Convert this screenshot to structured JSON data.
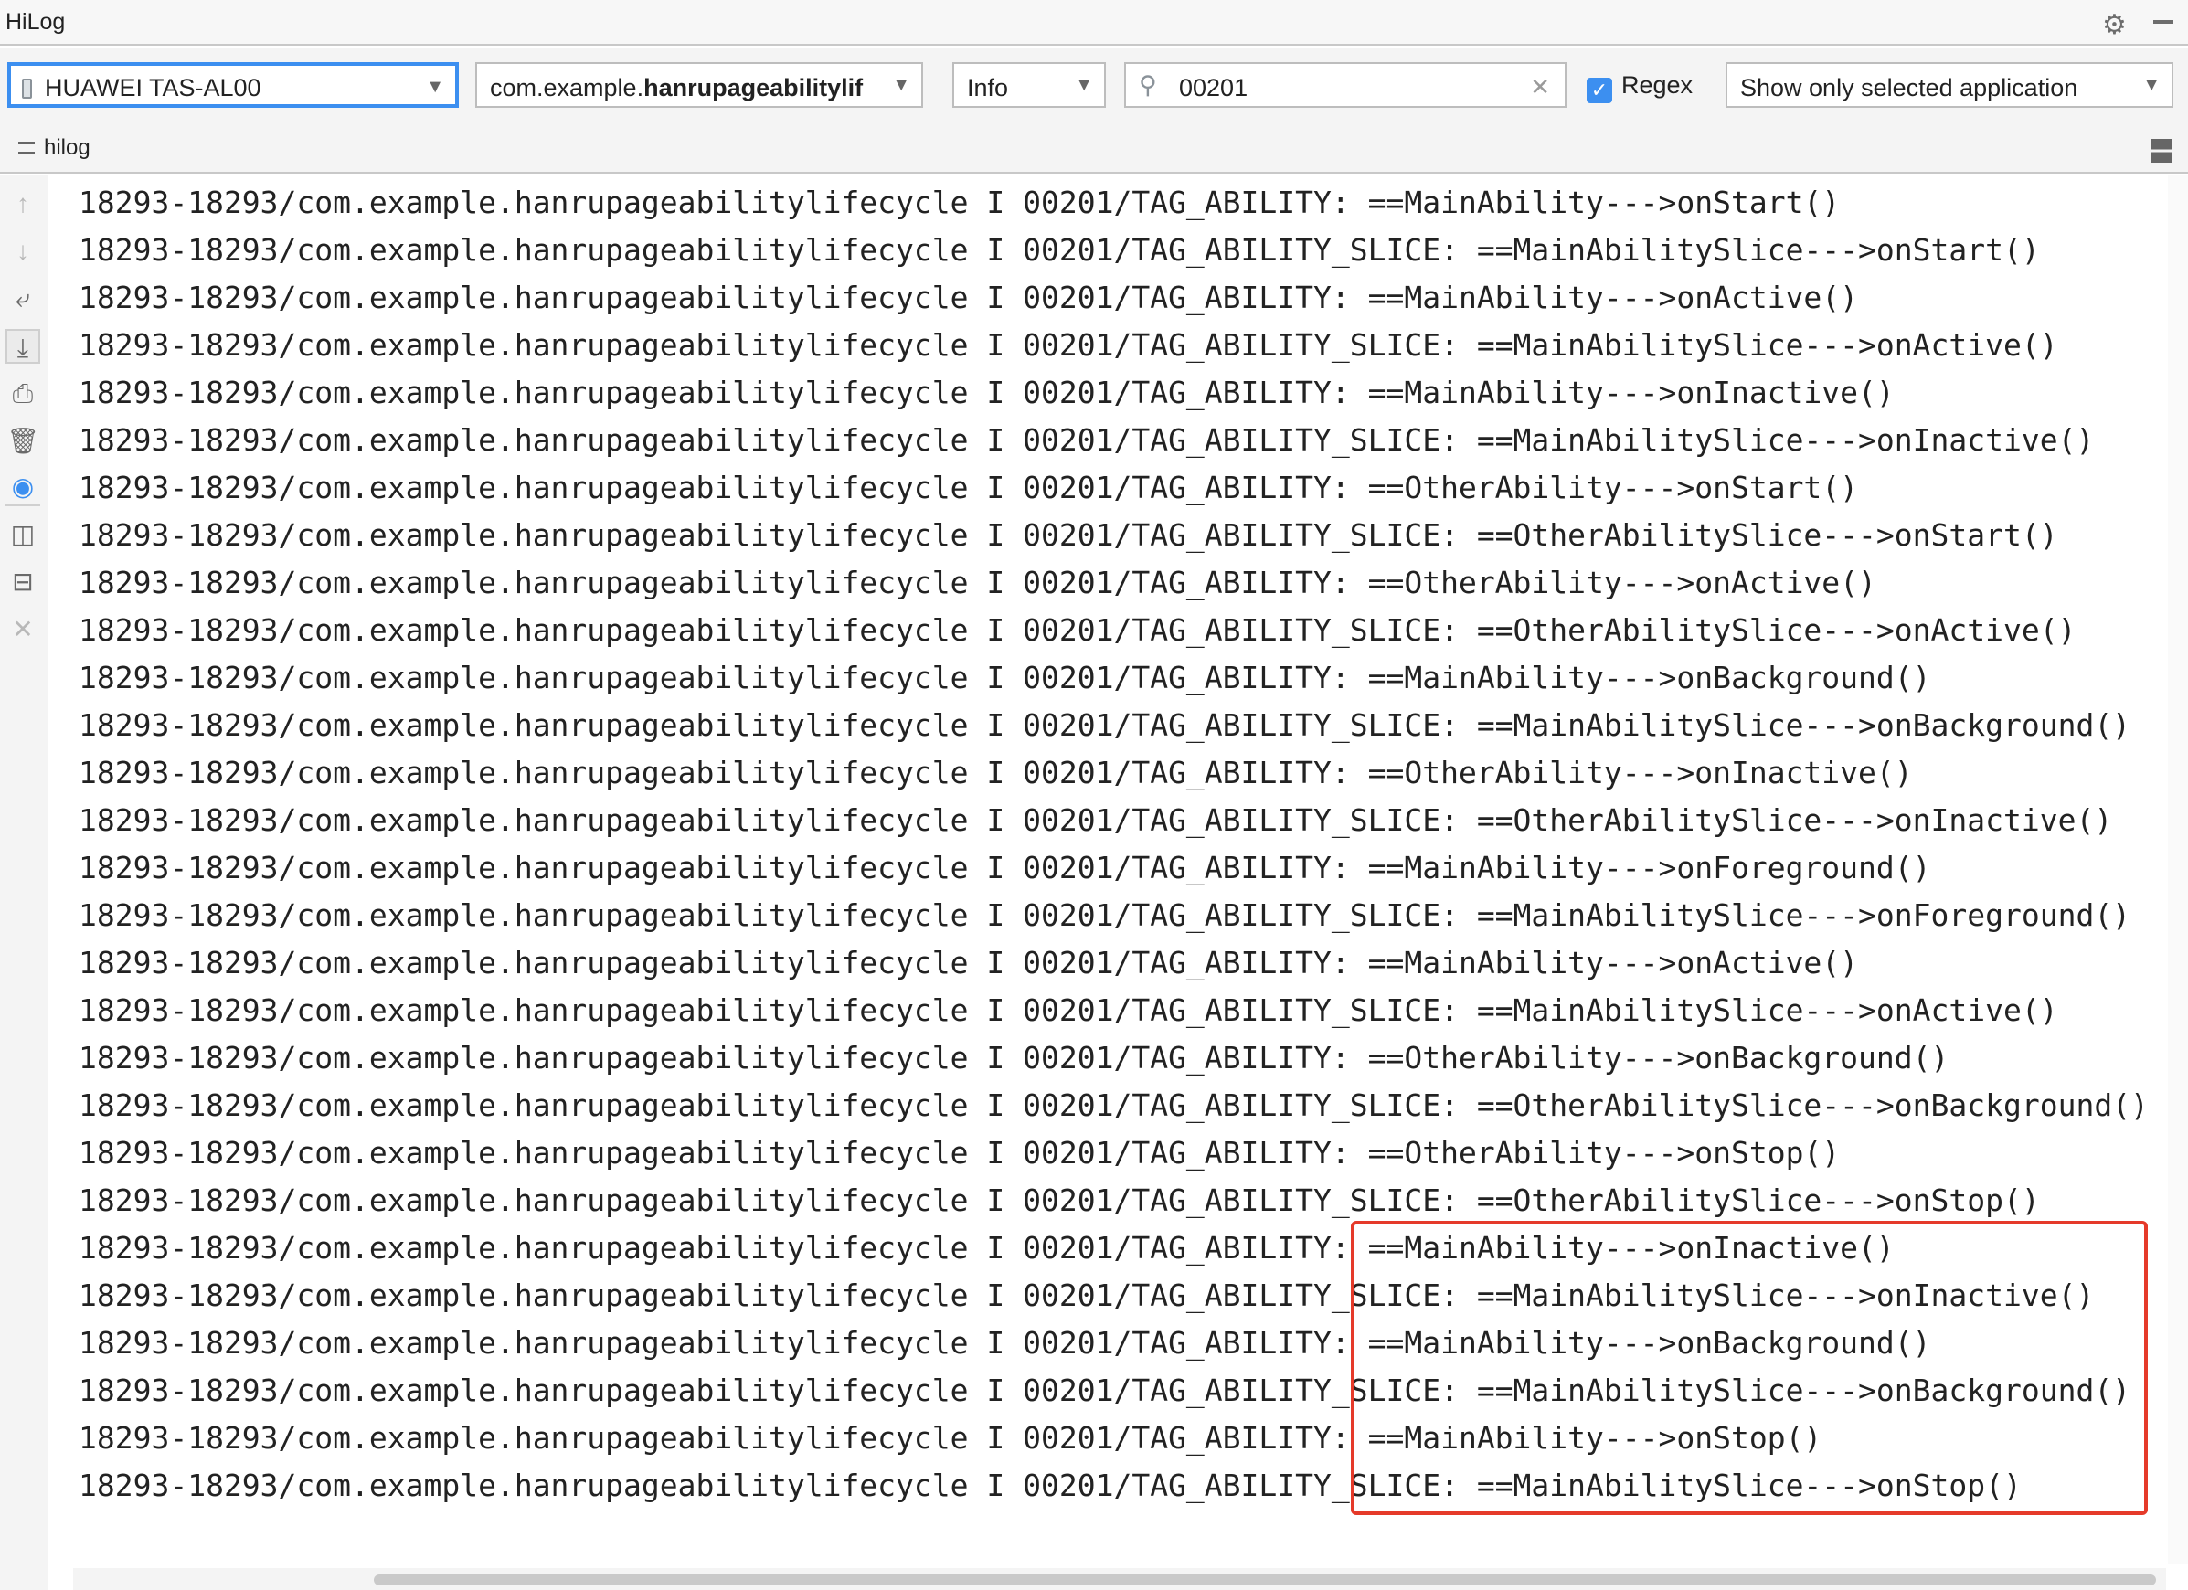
{
  "window": {
    "title": "HiLog"
  },
  "toolbar": {
    "device": "HUAWEI TAS-AL00",
    "app_prefix": "com.example.",
    "app_bold": "hanrupageabilitylif",
    "level": "Info",
    "search_value": "00201",
    "regex_label": "Regex",
    "regex_checked": true,
    "filter": "Show only selected application"
  },
  "subheader": {
    "label": "hilog"
  },
  "colors": {
    "accent": "#3c8ff0",
    "highlight_box": "#e53a2a"
  },
  "log_prefix": "18293-18293/com.example.hanrupageabilitylifecycle I 00201/",
  "log": [
    "TAG_ABILITY: ==MainAbility--->onStart()",
    "TAG_ABILITY_SLICE: ==MainAbilitySlice--->onStart()",
    "TAG_ABILITY: ==MainAbility--->onActive()",
    "TAG_ABILITY_SLICE: ==MainAbilitySlice--->onActive()",
    "TAG_ABILITY: ==MainAbility--->onInactive()",
    "TAG_ABILITY_SLICE: ==MainAbilitySlice--->onInactive()",
    "TAG_ABILITY: ==OtherAbility--->onStart()",
    "TAG_ABILITY_SLICE: ==OtherAbilitySlice--->onStart()",
    "TAG_ABILITY: ==OtherAbility--->onActive()",
    "TAG_ABILITY_SLICE: ==OtherAbilitySlice--->onActive()",
    "TAG_ABILITY: ==MainAbility--->onBackground()",
    "TAG_ABILITY_SLICE: ==MainAbilitySlice--->onBackground()",
    "TAG_ABILITY: ==OtherAbility--->onInactive()",
    "TAG_ABILITY_SLICE: ==OtherAbilitySlice--->onInactive()",
    "TAG_ABILITY: ==MainAbility--->onForeground()",
    "TAG_ABILITY_SLICE: ==MainAbilitySlice--->onForeground()",
    "TAG_ABILITY: ==MainAbility--->onActive()",
    "TAG_ABILITY_SLICE: ==MainAbilitySlice--->onActive()",
    "TAG_ABILITY: ==OtherAbility--->onBackground()",
    "TAG_ABILITY_SLICE: ==OtherAbilitySlice--->onBackground()",
    "TAG_ABILITY: ==OtherAbility--->onStop()",
    "TAG_ABILITY_SLICE: ==OtherAbilitySlice--->onStop()",
    "TAG_ABILITY: ==MainAbility--->onInactive()",
    "TAG_ABILITY_SLICE: ==MainAbilitySlice--->onInactive()",
    "TAG_ABILITY: ==MainAbility--->onBackground()",
    "TAG_ABILITY_SLICE: ==MainAbilitySlice--->onBackground()",
    "TAG_ABILITY: ==MainAbility--->onStop()",
    "TAG_ABILITY_SLICE: ==MainAbilitySlice--->onStop()"
  ],
  "icons": {
    "sidebar": [
      "arrow-up-icon",
      "arrow-down-icon",
      "soft-wrap-icon",
      "scroll-to-end-icon",
      "print-icon",
      "trash-icon",
      "camera-icon",
      "split-vertical-icon",
      "split-horizontal-icon",
      "close-icon"
    ]
  }
}
